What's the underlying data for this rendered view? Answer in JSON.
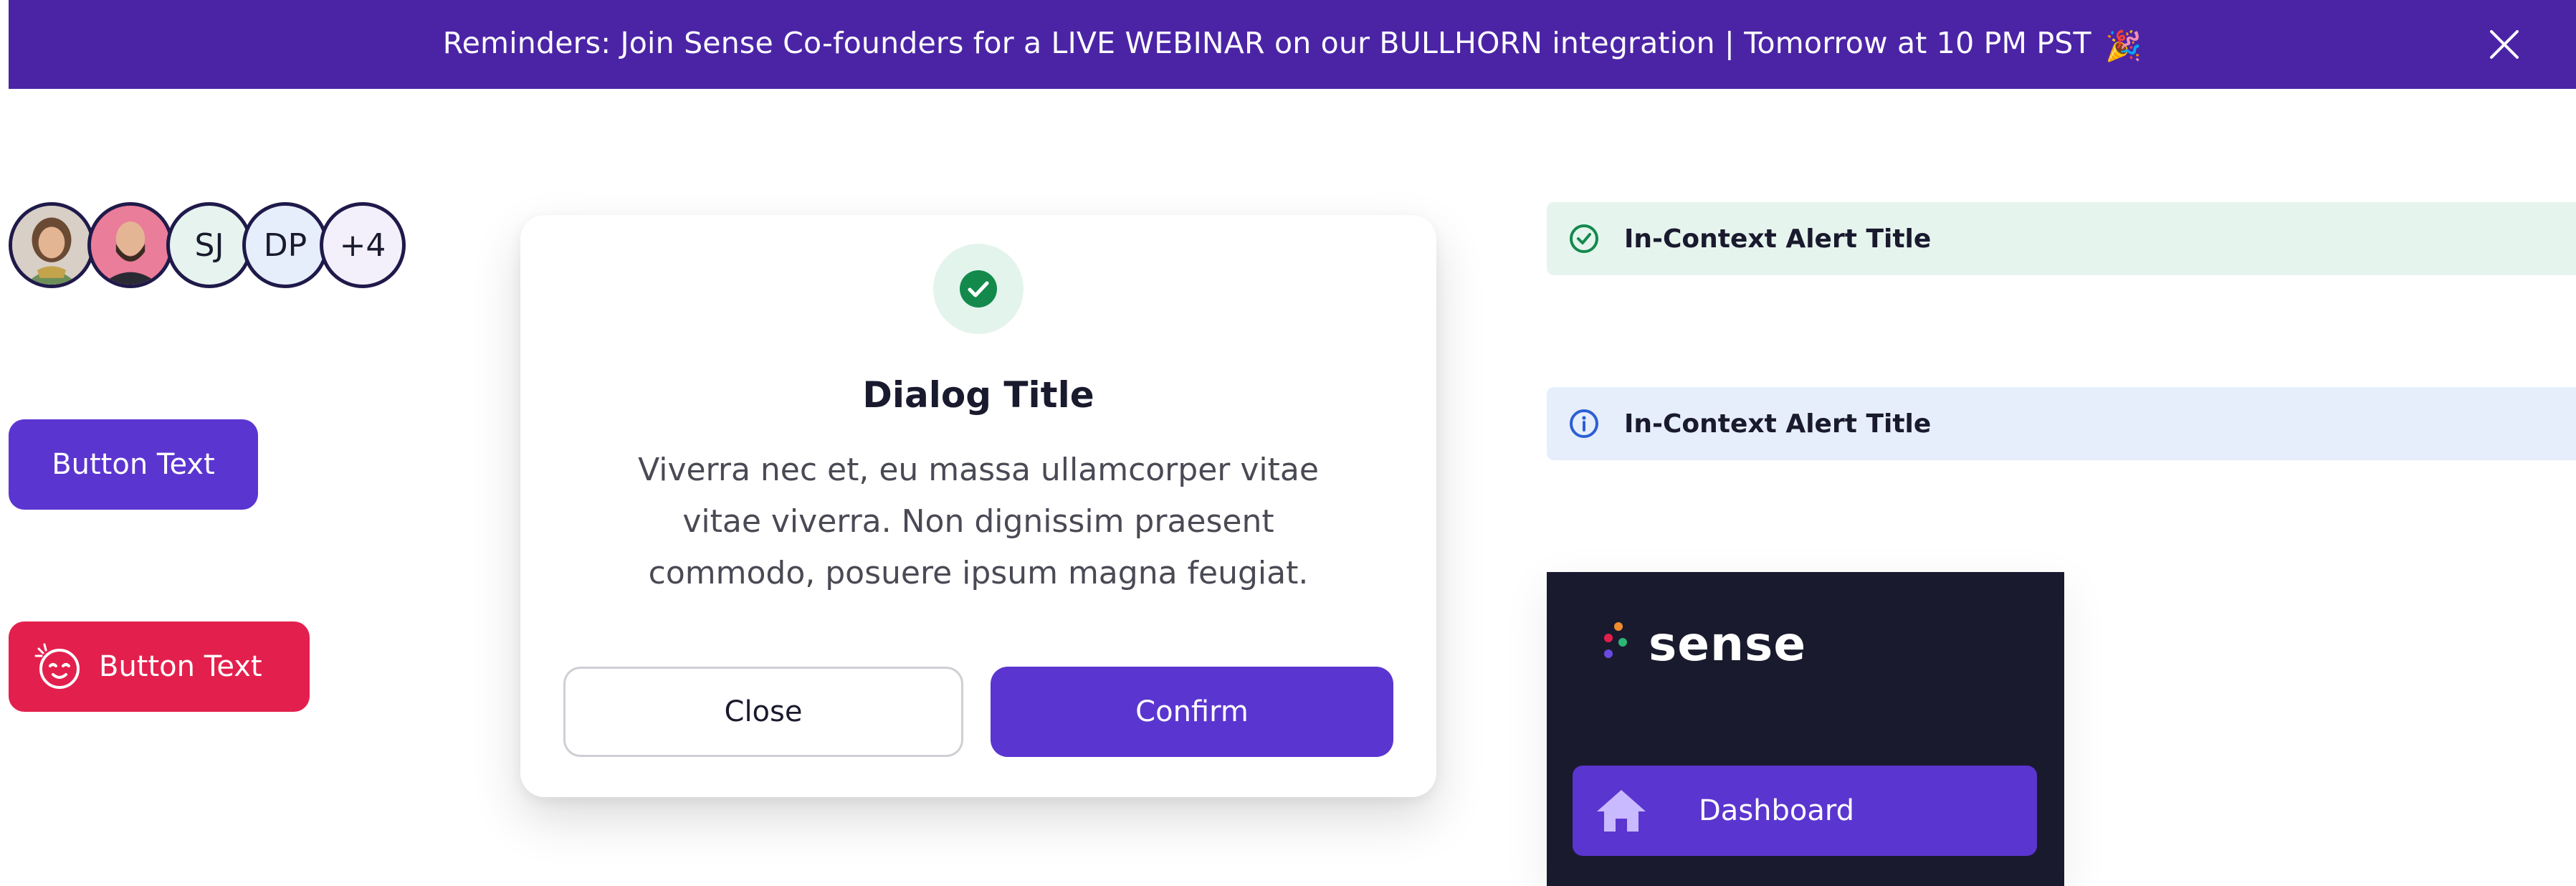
{
  "banner": {
    "text": "Reminders: Join Sense Co-founders for a LIVE WEBINAR  on our BULLHORN integration | Tomorrow at 10 PM PST",
    "emoji": "🎉",
    "close_icon": "close-icon"
  },
  "avatars": {
    "items": [
      {
        "type": "photo",
        "alt": "woman-avatar"
      },
      {
        "type": "photo",
        "alt": "man-avatar"
      },
      {
        "type": "initials",
        "label": "SJ"
      },
      {
        "type": "initials",
        "label": "DP"
      },
      {
        "type": "count",
        "label": "+4"
      }
    ]
  },
  "buttons": {
    "primary_label": "Button Text",
    "danger_label": "Button Text",
    "danger_icon": "emoji-face-icon"
  },
  "dialog": {
    "icon": "check-circle-icon",
    "title": "Dialog Title",
    "body": "Viverra nec et, eu massa ullamcorper vitae vitae viverra. Non dignissim praesent commodo, posuere ipsum magna feugiat.",
    "close_label": "Close",
    "confirm_label": "Confirm"
  },
  "alerts": [
    {
      "variant": "success",
      "icon": "check-circle-icon",
      "title": "In-Context Alert Title"
    },
    {
      "variant": "info",
      "icon": "info-circle-icon",
      "title": "In-Context Alert Title"
    }
  ],
  "sidebar": {
    "logo_text": "sense",
    "items": [
      {
        "icon": "home-icon",
        "label": "Dashboard",
        "active": true
      }
    ]
  },
  "colors": {
    "brand_purple": "#5b35d0",
    "banner_purple": "#4b24a6",
    "danger_red": "#e3204d",
    "success_green": "#138a4c",
    "info_blue": "#2c5fd6",
    "sidebar_bg": "#1a1a2e"
  }
}
